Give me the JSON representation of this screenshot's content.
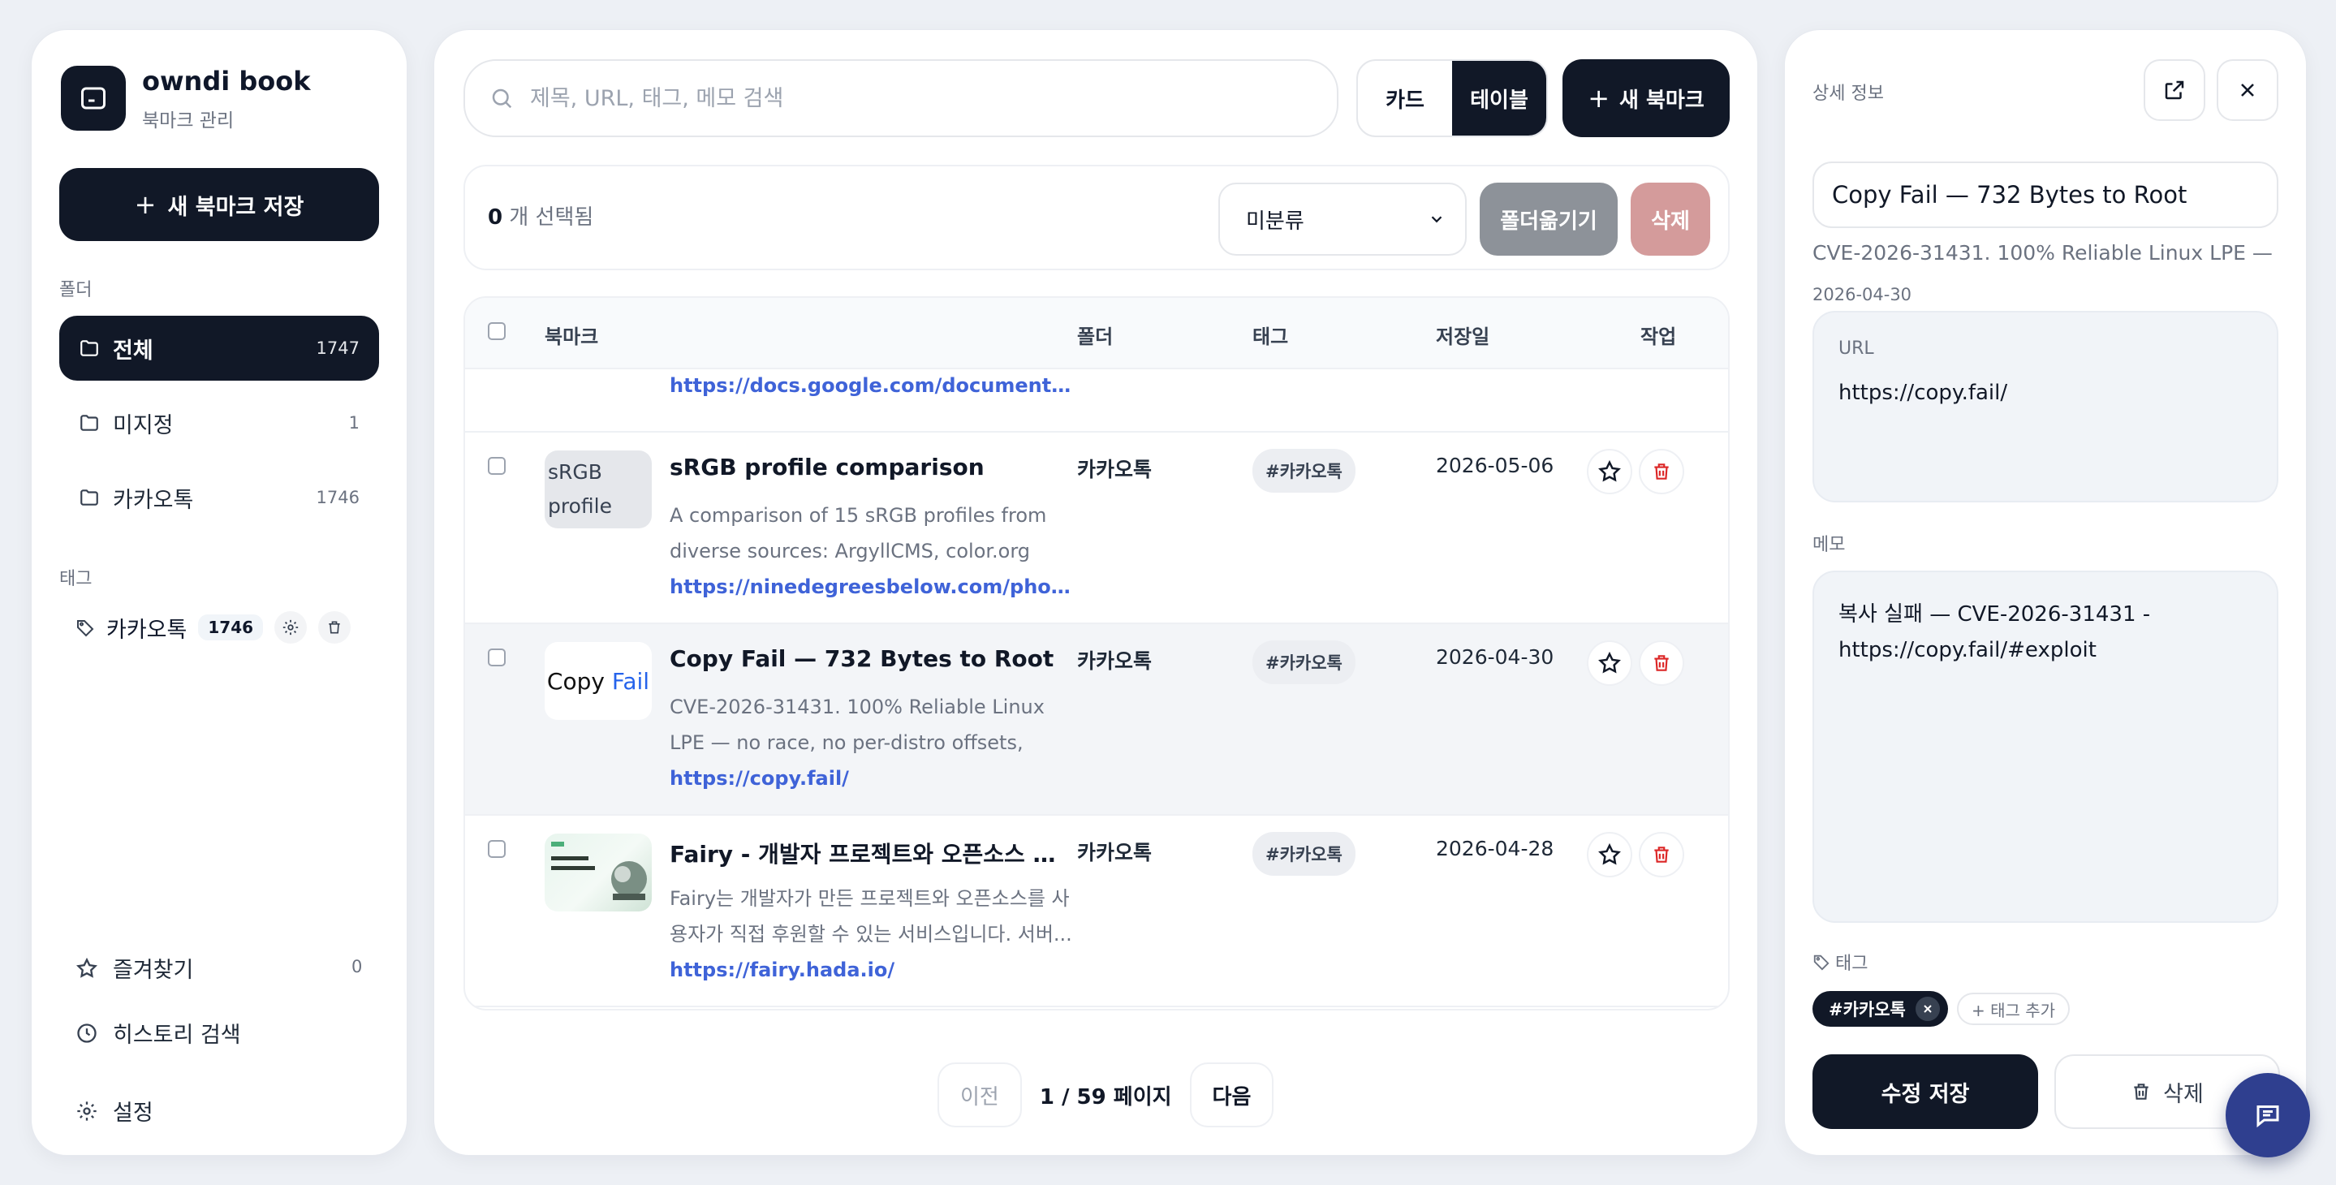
{
  "app": {
    "name": "owndi book",
    "subtitle": "북마크 관리"
  },
  "sidebar": {
    "new_save_label": "새 북마크 저장",
    "folders_label": "폴더",
    "folders": [
      {
        "name": "전체",
        "count": "1747"
      },
      {
        "name": "미지정",
        "count": "1"
      },
      {
        "name": "카카오톡",
        "count": "1746"
      }
    ],
    "tags_label": "태그",
    "tags": [
      {
        "name": "카카오톡",
        "count": "1746"
      }
    ],
    "favorites": {
      "label": "즐겨찾기",
      "count": "0"
    },
    "history_label": "히스토리 검색",
    "settings_label": "설정"
  },
  "toolbar": {
    "search_placeholder": "제목, URL, 태그, 메모 검색",
    "view_card": "카드",
    "view_table": "테이블",
    "new_bookmark": "새 북마크"
  },
  "selection": {
    "count": "0",
    "label": "개 선택됨",
    "folder_select": "미분류",
    "move_label": "폴더옮기기",
    "delete_label": "삭제"
  },
  "table": {
    "headers": {
      "bookmark": "북마크",
      "folder": "폴더",
      "tag": "태그",
      "date": "저장일",
      "action": "작업"
    },
    "partial_link": "https://docs.google.com/document/d/10...",
    "rows": [
      {
        "title": "sRGB profile comparison",
        "desc": "A comparison of 15 sRGB profiles from diverse sources: ArgyllCMS, color.org (two V2...",
        "url": "https://ninedegreesbelow.com/photograp...",
        "thumb_alt": "sRGB profile",
        "folder": "카카오톡",
        "tag": "#카카오톡",
        "date": "2026-05-06"
      },
      {
        "title": "Copy Fail — 732 Bytes to Root",
        "desc": "CVE-2026-31431. 100% Reliable Linux LPE — no race, no per-distro offsets, page-cache...",
        "url": "https://copy.fail/",
        "thumb_text_a": "Copy",
        "thumb_text_b": "Fail",
        "folder": "카카오톡",
        "tag": "#카카오톡",
        "date": "2026-04-30"
      },
      {
        "title": "Fairy - 개발자 프로젝트와 오픈소스 후원...",
        "desc": "Fairy는 개발자가 만든 프로젝트와 오픈소스를 사용자가 직접 후원할 수 있는 서비스입니다. 서버...",
        "url": "https://fairy.hada.io/",
        "folder": "카카오톡",
        "tag": "#카카오톡",
        "date": "2026-04-28"
      }
    ]
  },
  "pagination": {
    "prev": "이전",
    "current": "1 / 59",
    "page_word": "페이지",
    "next": "다음"
  },
  "detail": {
    "heading": "상세 정보",
    "title": "Copy Fail — 732 Bytes to Root",
    "subtitle": "CVE-2026-31431. 100% Reliable Linux LPE — n...",
    "date": "2026-04-30",
    "url_label": "URL",
    "url": "https://copy.fail/",
    "memo_label": "메모",
    "memo": "복사 실패 — CVE-2026-31431 - https://copy.fail/#exploit",
    "tags_label": "태그",
    "tags": [
      "#카카오톡"
    ],
    "add_tag": "+ 태그 추가",
    "save_label": "수정 저장",
    "delete_label": "삭제"
  },
  "colors": {
    "primary": "#111827",
    "link": "#3f63d8",
    "danger": "#dc2626",
    "fab": "#2f3f8f"
  }
}
